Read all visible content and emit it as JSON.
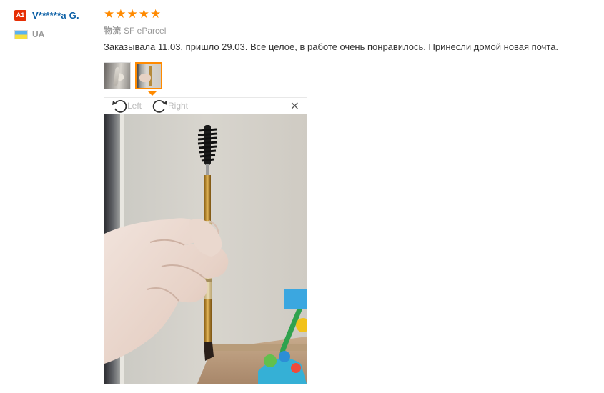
{
  "user": {
    "level_badge": "A1",
    "name": "V******a G.",
    "country": "UA"
  },
  "review": {
    "rating": 5,
    "stars": [
      "★",
      "★",
      "★",
      "★",
      "★"
    ],
    "shipping_label": "物流",
    "shipping_method": "SF eParcel",
    "text": "Заказывала 11.03, пришло 29.03. Все целое, в работе очень понравилось. Принесли домой новая почта."
  },
  "viewer": {
    "rotate_left_label": "Left",
    "rotate_right_label": "Right",
    "close_glyph": "×"
  },
  "colors": {
    "accent": "#ff8a00",
    "username": "#0b5fa5",
    "badge": "#e62e04"
  },
  "icons": {
    "rotate_left": "rotate-left-icon",
    "rotate_right": "rotate-right-icon",
    "close": "close-icon",
    "flag": "flag-ua-icon",
    "star": "star-icon"
  }
}
